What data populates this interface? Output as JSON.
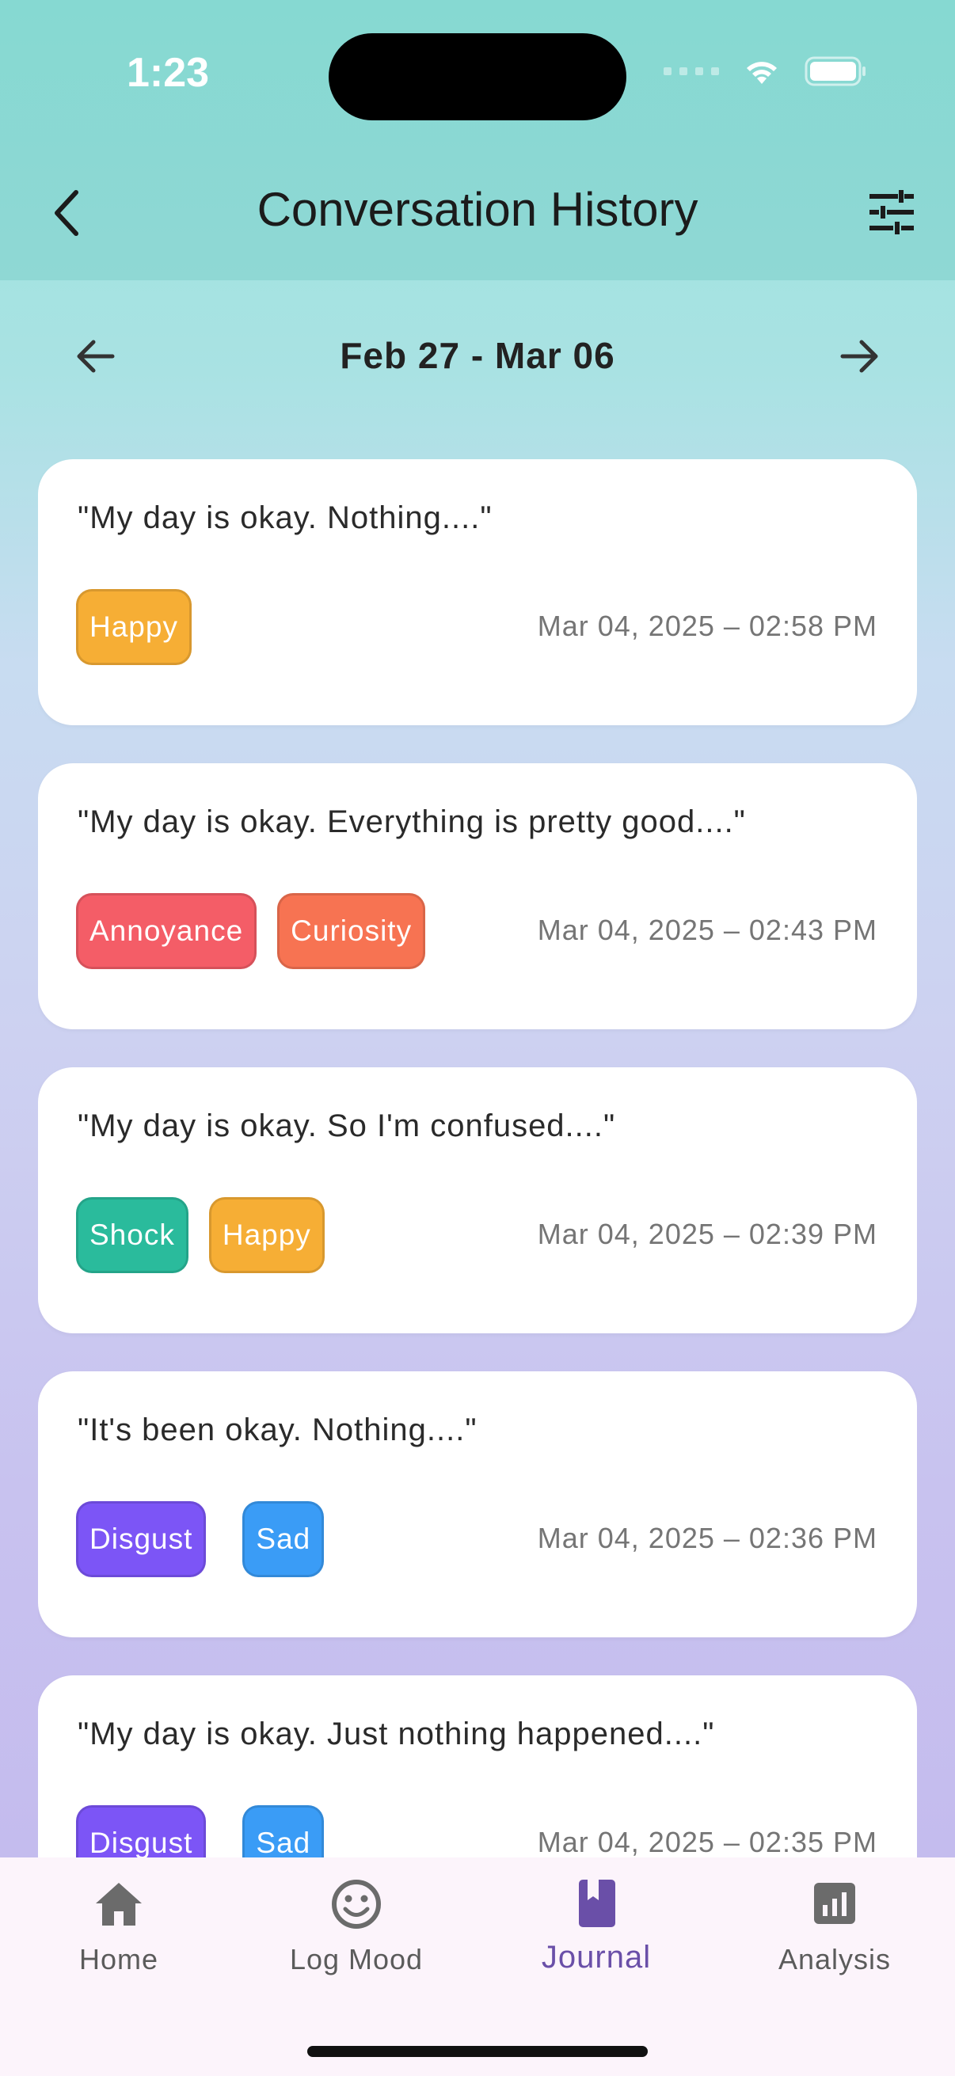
{
  "status_bar": {
    "time": "1:23"
  },
  "header": {
    "title": "Conversation History"
  },
  "week": {
    "range_label": "Feb 27 - Mar 06"
  },
  "entries": [
    {
      "quote": "\"My day is okay. Nothing....\"",
      "tags": [
        {
          "label": "Happy",
          "color": "#f6ae35"
        }
      ],
      "datetime": "Mar 04, 2025 – 02:58 PM"
    },
    {
      "quote": "\"My day is okay. Everything is pretty good....\"",
      "tags": [
        {
          "label": "Annoyance",
          "color": "#f45d67"
        },
        {
          "label": "Curiosity",
          "color": "#f77352"
        }
      ],
      "datetime": "Mar 04, 2025 – 02:43 PM"
    },
    {
      "quote": "\"My day is okay. So I'm confused....\"",
      "tags": [
        {
          "label": "Shock",
          "color": "#2abb9c"
        },
        {
          "label": "Happy",
          "color": "#f6ae35"
        }
      ],
      "datetime": "Mar 04, 2025 – 02:39 PM"
    },
    {
      "quote": "\"It's been okay. Nothing....\"",
      "tags": [
        {
          "label": "Disgust",
          "color": "#7c55f6"
        },
        {
          "label": "Sad",
          "color": "#3a9cf6"
        }
      ],
      "datetime": "Mar 04, 2025 – 02:36 PM"
    },
    {
      "quote": "\"My day is okay. Just nothing happened....\"",
      "tags": [
        {
          "label": "Disgust",
          "color": "#7c55f6"
        },
        {
          "label": "Sad",
          "color": "#3a9cf6"
        }
      ],
      "datetime": "Mar 04, 2025 – 02:35 PM"
    }
  ],
  "nav": {
    "items": [
      {
        "label": "Home",
        "icon": "home-icon",
        "active": false
      },
      {
        "label": "Log Mood",
        "icon": "smiley-icon",
        "active": false
      },
      {
        "label": "Journal",
        "icon": "bookmark-book-icon",
        "active": true
      },
      {
        "label": "Analysis",
        "icon": "bar-chart-icon",
        "active": false
      }
    ]
  }
}
